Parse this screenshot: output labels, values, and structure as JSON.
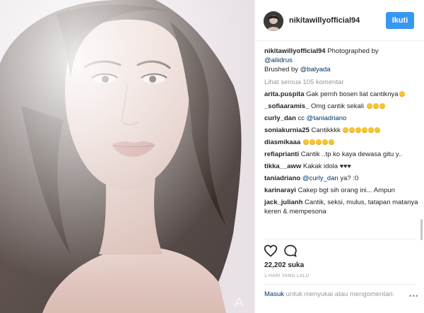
{
  "post": {
    "username": "nikitawillyofficial94",
    "follow_label": "Ikuti",
    "caption": {
      "username": "nikitawillyofficial94",
      "text_1": " Photographed by ",
      "mention_1": "@aliidrus",
      "text_2": "Brushed by ",
      "mention_2": "@balyada"
    },
    "view_all": "Lihat semua 105 komentar",
    "comments": [
      {
        "user": "arita.puspita",
        "text": " Gak pernh bosen liat cantiknya",
        "emoji_count": 1
      },
      {
        "user": "_sofiaaramis_",
        "text": " Omg cantik sekali ",
        "emoji_count": 3
      },
      {
        "user": "curly_dan",
        "text": " cc ",
        "mention": "@taniadriano"
      },
      {
        "user": "soniakurnia25",
        "text": " Cantikkkk ",
        "emoji_count": 6
      },
      {
        "user": "diasmikaaa",
        "text": " ",
        "emoji_count": 5
      },
      {
        "user": "refiaprianti",
        "text": " Cantik ..tp ko kaya dewasa gitu y.."
      },
      {
        "user": "tikka__aww",
        "text": " Kakak idola ",
        "hearts": "♥♥♥"
      },
      {
        "user": "taniadriano",
        "text": " ",
        "mention": "@curly_dan",
        "text_after": " ya? :0"
      },
      {
        "user": "karinarayi",
        "text": " Cakep bgt sih orang ini... Ampun"
      },
      {
        "user": "jack_julianh",
        "text": " Cantik, seksi, mulus, tatapan matanya keren & mempesona"
      }
    ],
    "likes": "22,202 suka",
    "time_ago": "1 HARI YANG LALU",
    "add_comment": {
      "login": "Masuk",
      "text": " untuk menyukai atau mengomentari."
    },
    "more": "•••"
  },
  "icons": {
    "like": "heart-outline-icon",
    "comment": "speech-bubble-icon",
    "more": "more-options-icon",
    "watermark": "photographer-logo-icon"
  },
  "colors": {
    "follow_button": "#3897f0",
    "mention": "#003569",
    "muted": "#999999",
    "text": "#262626"
  }
}
